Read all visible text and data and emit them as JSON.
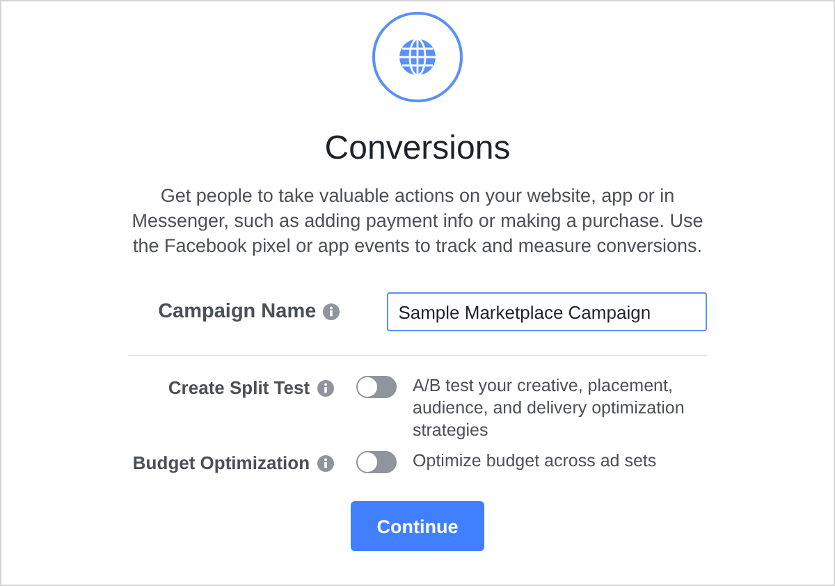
{
  "title": "Conversions",
  "description": "Get people to take valuable actions on your website, app or in Messenger, such as adding payment info or making a purchase. Use the Facebook pixel or app events to track and measure conversions.",
  "campaign_name": {
    "label": "Campaign Name",
    "value": "Sample Marketplace Campaign"
  },
  "options": [
    {
      "label": "Create Split Test",
      "on": false,
      "text": "A/B test your creative, placement, audience, and delivery optimization strategies"
    },
    {
      "label": "Budget Optimization",
      "on": false,
      "text": "Optimize budget across ad sets"
    }
  ],
  "button": "Continue"
}
